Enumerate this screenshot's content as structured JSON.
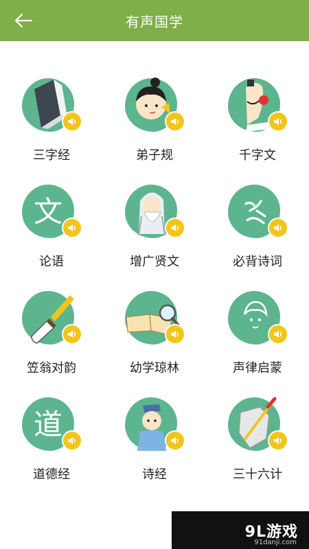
{
  "header": {
    "title": "有声国学",
    "back_icon": "back-arrow-icon",
    "bg_color": "#7fae4a"
  },
  "items": [
    {
      "label": "三字经",
      "icon": "book-icon"
    },
    {
      "label": "弟子规",
      "icon": "child-scholar-icon"
    },
    {
      "label": "千字文",
      "icon": "scholar-writing-icon"
    },
    {
      "label": "论语",
      "icon": "wen-character-icon"
    },
    {
      "label": "增广贤文",
      "icon": "old-sage-icon"
    },
    {
      "label": "必背诗词",
      "icon": "calligraphy-icon"
    },
    {
      "label": "笠翁对韵",
      "icon": "brush-icon"
    },
    {
      "label": "幼学琼林",
      "icon": "open-book-magnifier-icon"
    },
    {
      "label": "声律启蒙",
      "icon": "girl-icon"
    },
    {
      "label": "道德经",
      "icon": "dao-character-icon"
    },
    {
      "label": "诗经",
      "icon": "boy-scholar-icon"
    },
    {
      "label": "三十六计",
      "icon": "sword-shield-icon"
    }
  ],
  "colors": {
    "blob": "#5cb58e",
    "speaker": "#f2c51c"
  },
  "watermark": {
    "text": "9L游戏",
    "sub": "91danji.com"
  }
}
